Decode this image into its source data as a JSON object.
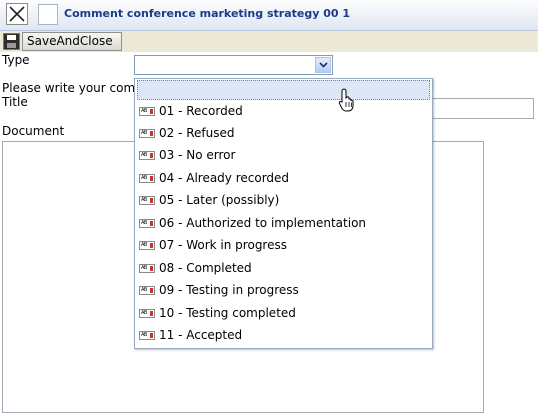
{
  "window": {
    "title": "Comment conference marketing strategy 00 1"
  },
  "toolbar": {
    "save_close_label": "SaveAndClose"
  },
  "form": {
    "type_label": "Type",
    "note_label": "Please write your comm",
    "title_label": "Title",
    "document_label": "Document",
    "type_value": "",
    "title_value": "",
    "document_value": ""
  },
  "dropdown": {
    "items": [
      "01 - Recorded",
      "02 - Refused",
      "03 - No error",
      "04 - Already recorded",
      "05 - Later (possibly)",
      "06 - Authorized to implementation",
      "07 - Work in progress",
      "08 - Completed",
      "09 - Testing in progress",
      "10 - Testing completed",
      "11 - Accepted"
    ]
  },
  "icons": {
    "close": "close-icon",
    "save": "save-icon",
    "chevron": "chevron-down-icon",
    "item": "text-field-icon",
    "cursor": "hand-pointer-icon"
  },
  "colors": {
    "title_text": "#1d3a8a",
    "titlebar_bottom": "#dfe7f3",
    "toolbar_bg": "#ece9d8",
    "highlight": "#dce6f6"
  }
}
